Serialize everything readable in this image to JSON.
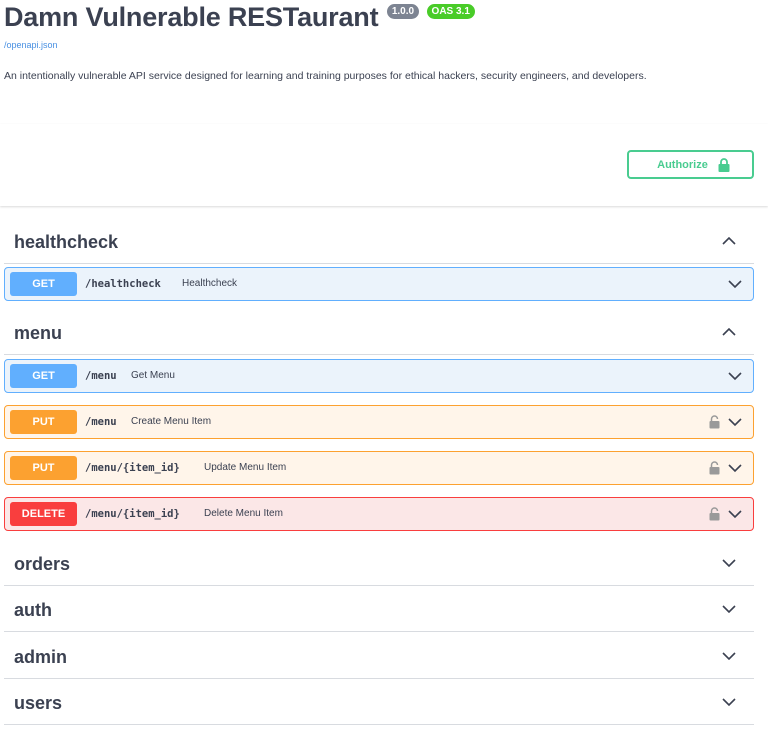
{
  "info": {
    "title": "Damn Vulnerable RESTaurant",
    "version": "1.0.0",
    "oas": "OAS 3.1",
    "spec_link": "/openapi.json",
    "description": "An intentionally vulnerable API service designed for learning and training purposes for ethical hackers, security engineers, and developers."
  },
  "auth": {
    "authorize_label": "Authorize"
  },
  "tags": [
    {
      "name": "healthcheck",
      "expanded": true,
      "operations": [
        {
          "method": "GET",
          "path": "/healthcheck",
          "summary": "Healthcheck",
          "locked": false
        }
      ]
    },
    {
      "name": "menu",
      "expanded": true,
      "operations": [
        {
          "method": "GET",
          "path": "/menu",
          "summary": "Get Menu",
          "locked": false
        },
        {
          "method": "PUT",
          "path": "/menu",
          "summary": "Create Menu Item",
          "locked": true
        },
        {
          "method": "PUT",
          "path": "/menu/{item_id}",
          "summary": "Update Menu Item",
          "locked": true
        },
        {
          "method": "DELETE",
          "path": "/menu/{item_id}",
          "summary": "Delete Menu Item",
          "locked": true
        }
      ]
    },
    {
      "name": "orders",
      "expanded": false
    },
    {
      "name": "auth",
      "expanded": false
    },
    {
      "name": "admin",
      "expanded": false
    },
    {
      "name": "users",
      "expanded": false
    }
  ],
  "colors": {
    "get": "#61affe",
    "put": "#fca130",
    "delete": "#f93e3e",
    "authorize": "#49cc90"
  },
  "icons": {
    "lock": "lock-icon",
    "chevron_up": "chevron-up-icon",
    "chevron_down": "chevron-down-icon"
  }
}
